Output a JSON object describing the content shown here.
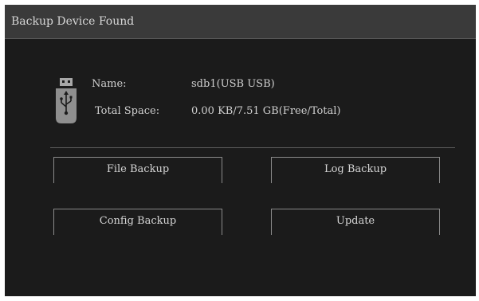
{
  "dialog": {
    "title": "Backup Device Found"
  },
  "device": {
    "icon": "usb-drive-icon",
    "name_label": "Name:",
    "name_value": "sdb1(USB USB)",
    "space_label": "Total Space:",
    "space_value": "0.00 KB/7.51 GB(Free/Total)"
  },
  "buttons": {
    "file_backup": "File Backup",
    "log_backup": "Log Backup",
    "config_backup": "Config Backup",
    "update": "Update"
  }
}
